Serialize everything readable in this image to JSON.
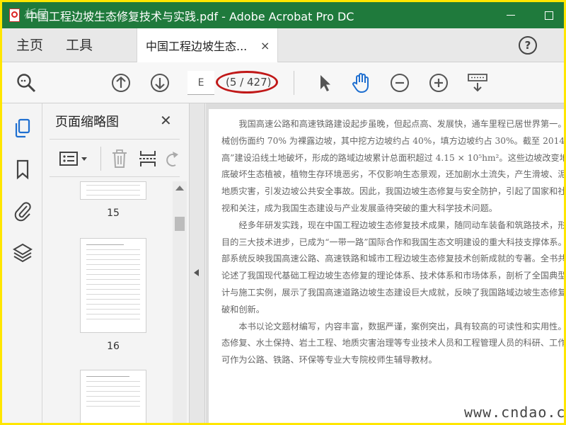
{
  "window": {
    "title": "中国工程边坡生态修复技术与实践.pdf - Adobe Acrobat Pro DC",
    "corner_mark": "析目"
  },
  "tabs": {
    "home": "主页",
    "tools": "工具",
    "document": "中国工程边坡生态...",
    "close": "×",
    "help": "?"
  },
  "toolbar": {
    "page_input": "E",
    "page_count": "(5 / 427)"
  },
  "panel": {
    "title": "页面缩略图",
    "close": "✕",
    "thumbnails": [
      {
        "number": "15"
      },
      {
        "number": "16"
      }
    ]
  },
  "document": {
    "paragraphs": [
      "我国高速公路和高速铁路建设起步虽晚，但起点高、发展快，通车里程已居世界第一。工程建设机械创伤面约 70% 为裸露边坡，其中挖方边坡约占 40%，填方边坡约占 30%。截至 2014 年，仅“两高”建设沿线土地破坏，形成的路域边坡累计总面积超过 4.15 × 10⁵hm²。这些边坡改变地形地貌，彻底破坏生态植被，植物生存环境恶劣，不仅影响生态景观，还加剧水土流失，产生滑坡、泥石流等次生地质灾害，引发边坡公共安全事故。因此，我国边坡生态修复与安全防护，引起了国家和社会的高度重视和关注，成为我国生态建设与产业发展亟待突破的重大科学技术问题。",
      "经多年研发实践，现在中国工程边坡生态修复技术成果，随同动车装备和筑路技术，形成了举世瞩目的三大技术进步，已成为“一带一路”国际合作和我国生态文明建设的重大科技支撑体系。本书是第一部系统反映我国高速公路、高速铁路和城市工程边坡生态修复技术创新成就的专著。全书共分十三章，论述了我国现代基础工程边坡生态修复的理论体系、技术体系和市场体系，剖析了全国典型工程生态设计与施工实例，展示了我国高速道路边坡生态建设巨大成就，反映了我国路域边坡生态修复重大科学突破和创新。",
      "本书以论文题材编写，内容丰富，数据严谨，案例突出，具有较高的可读性和实用性。既可作为生态修复、水土保持、岩土工程、地质灾害治理等专业技术人员和工程管理人员的科研、工作参考书，亦可作为公路、铁路、环保等专业大专院校师生辅导教材。"
    ]
  },
  "watermark": "www.cndao.com",
  "colors": {
    "titlebar": "#1f7a3c",
    "frame_border": "#ffe600",
    "annotation": "#c01818",
    "hand_tool": "#1f6fd0",
    "nav_icon": "#1f6fd0"
  }
}
